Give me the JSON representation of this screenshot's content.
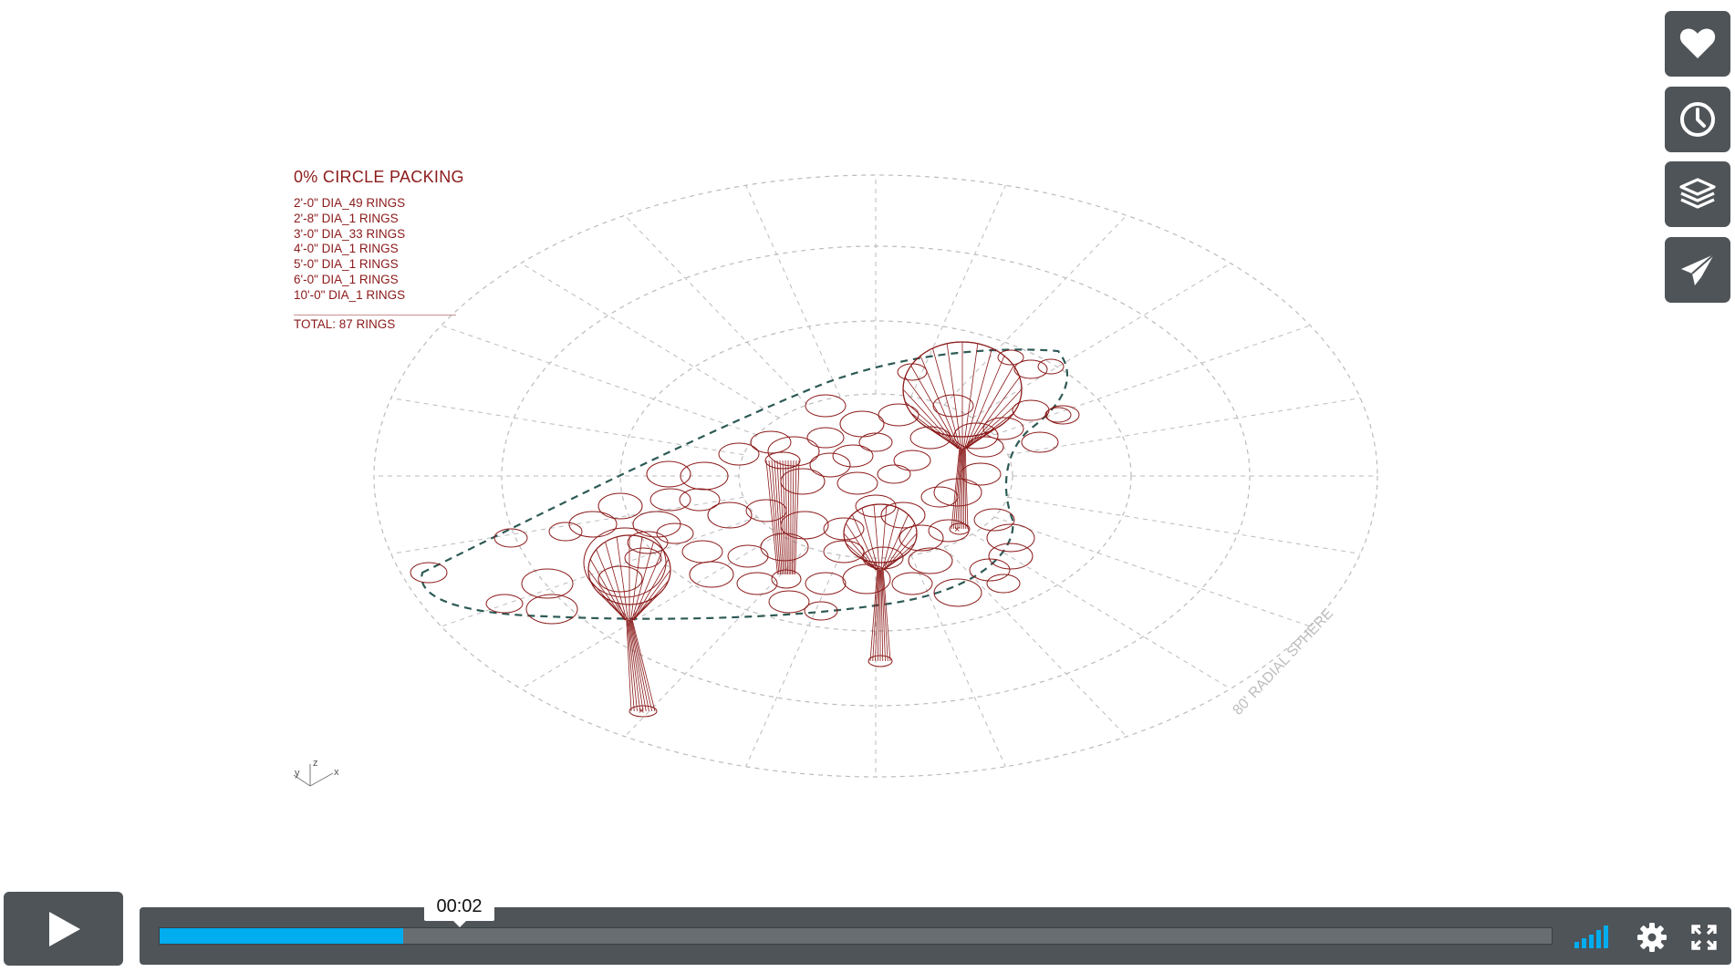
{
  "legend": {
    "title": "0% CIRCLE PACKING",
    "rows": [
      "2'-0\" DIA_49 RINGS",
      "2'-8\" DIA_1 RINGS",
      "3'-0\" DIA_33 RINGS",
      "4'-0\" DIA_1 RINGS",
      "5'-0\" DIA_1 RINGS",
      "6'-0\" DIA_1 RINGS",
      "10'-0\" DIA_1 RINGS"
    ],
    "total": "TOTAL: 87 RINGS"
  },
  "drawing": {
    "sphere_label": "80' RADIAL SPHERE",
    "axes": {
      "x": "x",
      "y": "y",
      "z": "z"
    }
  },
  "player": {
    "current_time": "00:02",
    "progress": 0.175,
    "accent_color": "#00adef",
    "side_buttons": [
      {
        "name": "like",
        "icon": "heart-icon"
      },
      {
        "name": "watch-later",
        "icon": "clock-icon"
      },
      {
        "name": "collections",
        "icon": "layers-icon"
      },
      {
        "name": "share",
        "icon": "paper-plane-icon"
      }
    ],
    "control_icons": [
      "volume-icon",
      "settings-icon",
      "fullscreen-icon"
    ]
  },
  "colors": {
    "drawing_line": "#8b1a1a",
    "boundary": "#2d5a55",
    "grid": "#bbbbbb",
    "controls_bg": "#4f5458"
  }
}
